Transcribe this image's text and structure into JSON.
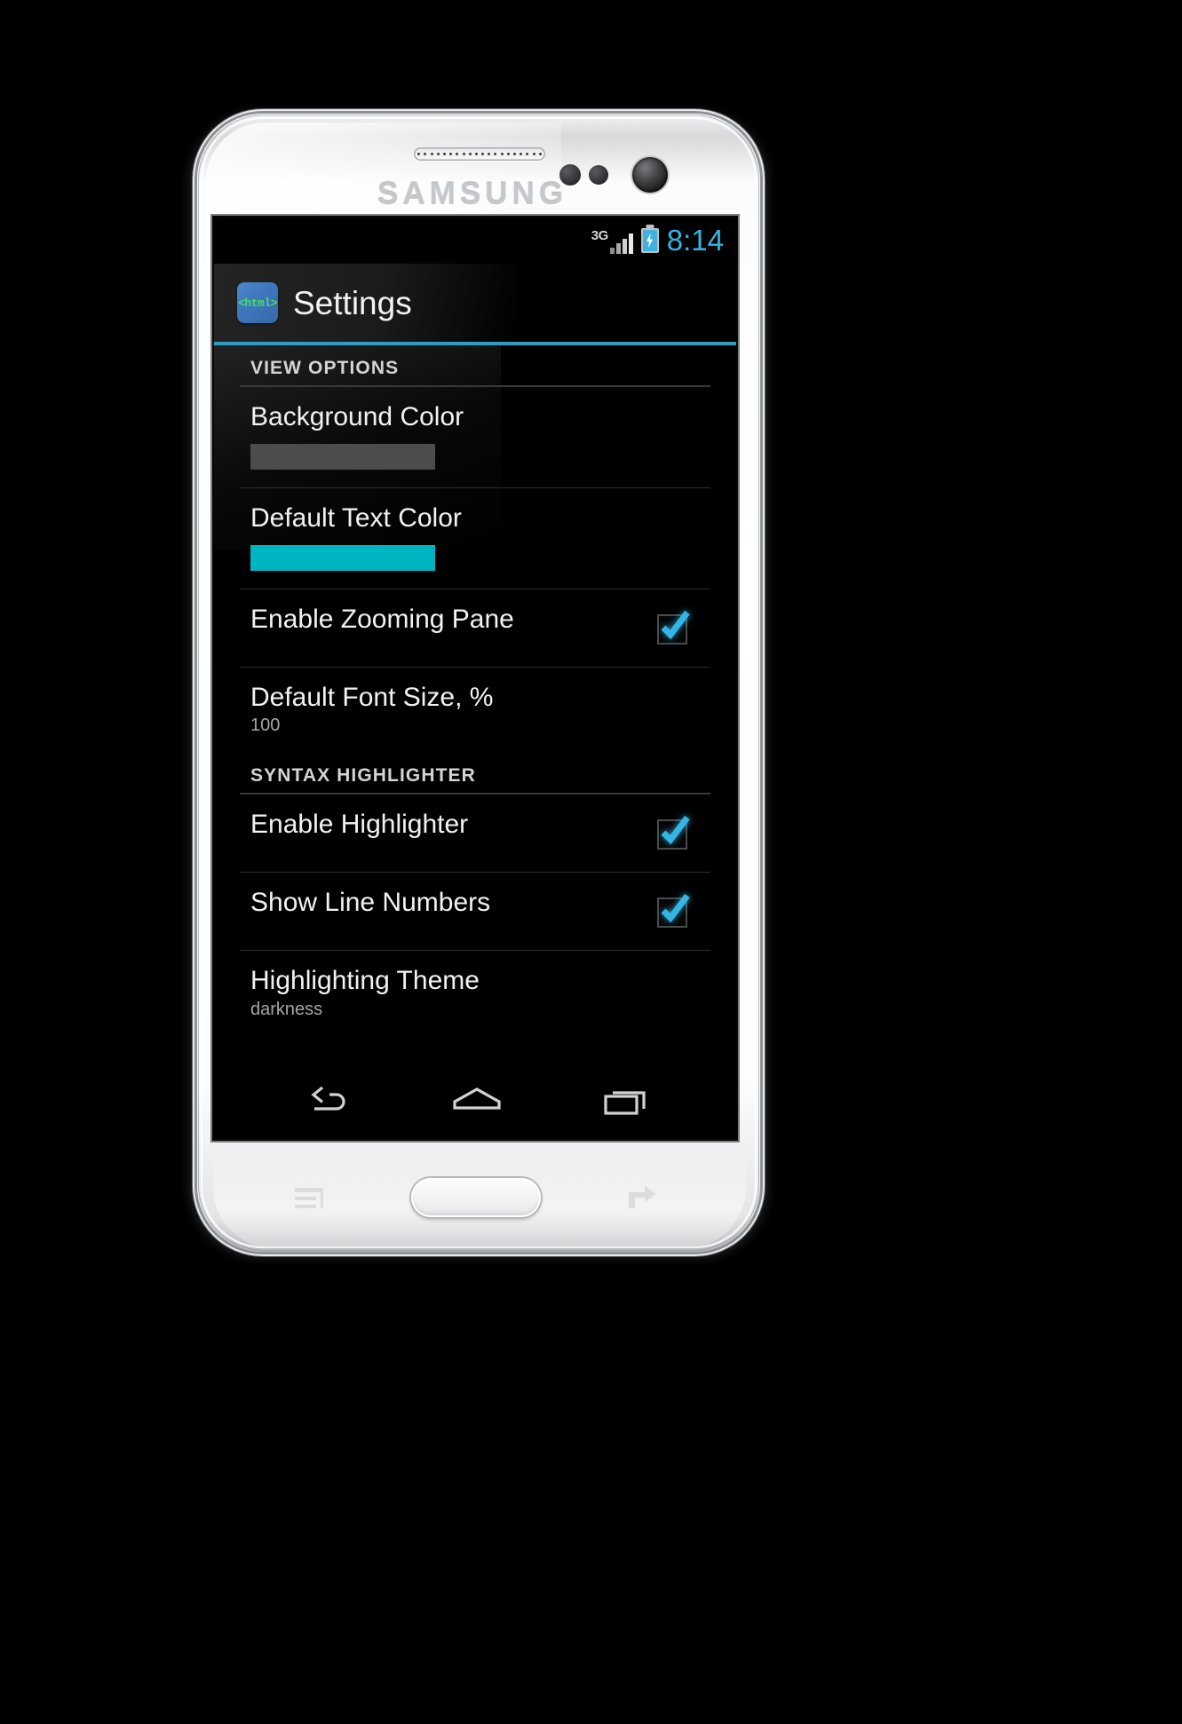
{
  "device": {
    "brand": "SAMSUNG",
    "earpiece_icon": "speaker-grille-icon",
    "camera_icon": "front-camera-icon",
    "home_button_label": "",
    "menu_key_icon": "menu-icon",
    "back_key_icon": "back-icon"
  },
  "statusbar": {
    "network_type": "3G",
    "signal_icon": "signal-bars-icon",
    "battery_icon": "battery-charging-icon",
    "time": "8:14"
  },
  "actionbar": {
    "app_icon_text": "<html>",
    "app_icon_name": "html-app-icon",
    "title": "Settings",
    "accent_color": "#2d9dc4"
  },
  "sections": [
    {
      "header": "VIEW OPTIONS",
      "rows": [
        {
          "type": "color",
          "name": "background-color",
          "title": "Background Color",
          "swatch_color": "#4c4c4c"
        },
        {
          "type": "color",
          "name": "default-text-color",
          "title": "Default Text Color",
          "swatch_color": "#00b5c2"
        },
        {
          "type": "checkbox",
          "name": "enable-zooming-pane",
          "title": "Enable Zooming Pane",
          "checked": "true"
        },
        {
          "type": "value",
          "name": "default-font-size",
          "title": "Default Font Size, %",
          "value": "100"
        }
      ]
    },
    {
      "header": "SYNTAX HIGHLIGHTER",
      "rows": [
        {
          "type": "checkbox",
          "name": "enable-highlighter",
          "title": "Enable Highlighter",
          "checked": "true"
        },
        {
          "type": "checkbox",
          "name": "show-line-numbers",
          "title": "Show Line Numbers",
          "checked": "true"
        },
        {
          "type": "value",
          "name": "highlighting-theme",
          "title": "Highlighting Theme",
          "value": "darkness"
        }
      ]
    }
  ],
  "navbar": {
    "back_label": "Back",
    "home_label": "Home",
    "recents_label": "Recents"
  },
  "colors": {
    "accent": "#33b5e5",
    "divider": "#2c2c2c",
    "section_divider": "#3a3a3a",
    "screen_bg": "#000000"
  }
}
